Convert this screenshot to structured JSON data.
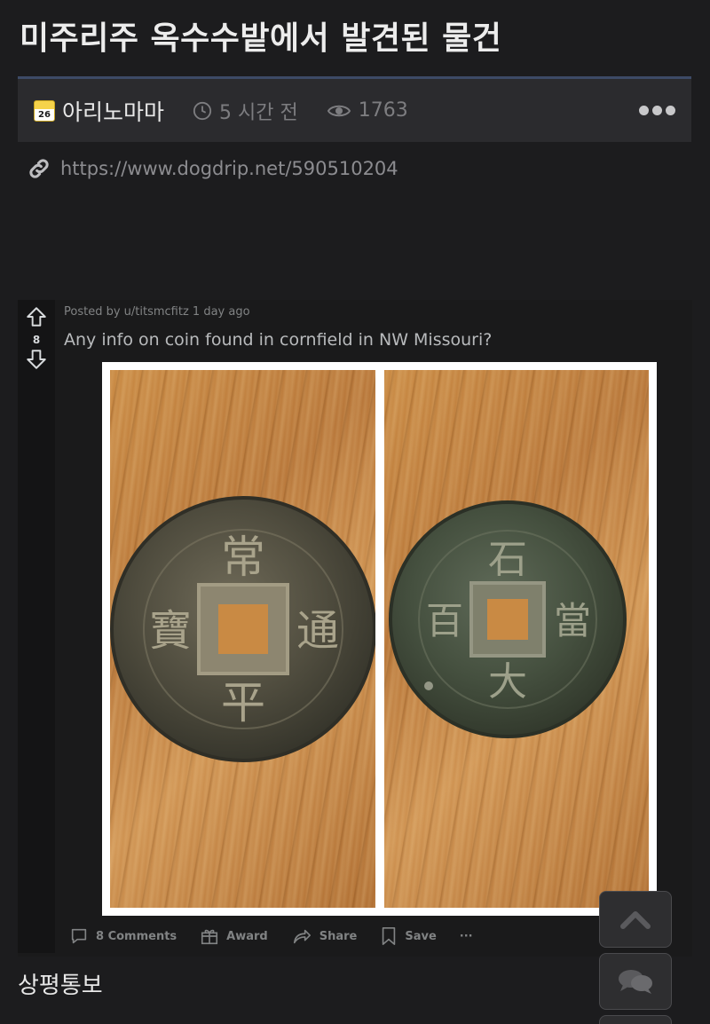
{
  "page": {
    "title": "미주리주 옥수수밭에서 발견된 물건"
  },
  "meta": {
    "level_badge": "26",
    "author": "아리노마마",
    "time_ago": "5 시간 전",
    "views": "1763",
    "source_url": "https://www.dogdrip.net/590510204"
  },
  "embed": {
    "posted_by": "Posted by u/titsmcfitz 1 day ago",
    "vote_count": "8",
    "title": "Any info on coin found in cornfield in NW Missouri?",
    "coin_left_characters": [
      "常",
      "平",
      "通",
      "寶"
    ],
    "coin_right_characters": [
      "石",
      "大",
      "當",
      "百"
    ],
    "actions": {
      "comments": "8 Comments",
      "award": "Award",
      "share": "Share",
      "save": "Save",
      "more": "···"
    }
  },
  "body": {
    "caption": "상평통보"
  },
  "icons": {
    "clock": "clock-icon",
    "eye": "eye-icon",
    "link": "link-icon",
    "upvote": "upvote-arrow-icon",
    "downvote": "downvote-arrow-icon",
    "scroll_top": "chevron-up-icon",
    "chat": "chat-bubbles-icon"
  },
  "colors": {
    "background": "#1c1c1e",
    "meta_bar": "#2b2b2e",
    "accent_border": "#3d4a66",
    "muted_text": "#818384"
  }
}
